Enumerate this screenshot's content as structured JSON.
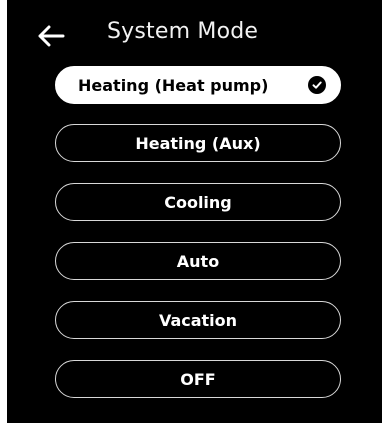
{
  "header": {
    "title": "System Mode",
    "back_icon": "arrow-left-icon"
  },
  "options": [
    {
      "label": "Heating (Heat pump)",
      "selected": true,
      "icon": "check-circle-icon"
    },
    {
      "label": "Heating (Aux)",
      "selected": false
    },
    {
      "label": "Cooling",
      "selected": false
    },
    {
      "label": "Auto",
      "selected": false
    },
    {
      "label": "Vacation",
      "selected": false
    },
    {
      "label": "OFF",
      "selected": false
    }
  ],
  "colors": {
    "background": "#000000",
    "selected_fill": "#ffffff",
    "outline": "#d8d8d8",
    "text": "#ffffff"
  }
}
